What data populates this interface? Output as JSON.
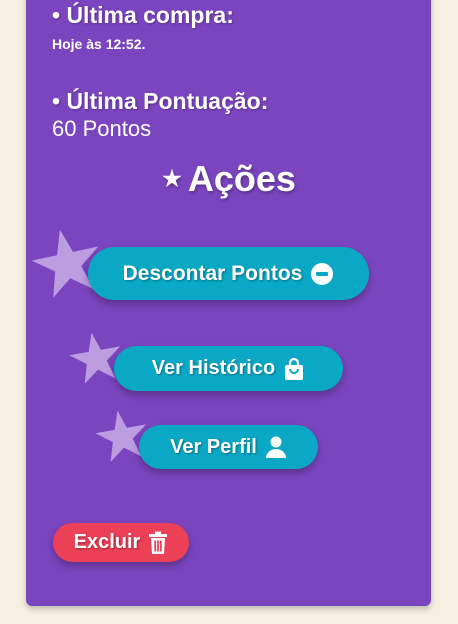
{
  "info": {
    "last_purchase_label": "• Última compra:",
    "last_purchase_value": "Hoje às 12:52.",
    "last_score_label": "• Última Pontuação:",
    "last_score_value": "60 Pontos"
  },
  "actions": {
    "heading": "Ações",
    "heading_icon": "star-icon",
    "discount_label": "Descontar Pontos",
    "discount_icon": "minus-circle-icon",
    "history_label": "Ver Histórico",
    "history_icon": "shopping-bag-icon",
    "profile_label": "Ver Perfil",
    "profile_icon": "user-icon",
    "delete_label": "Excluir",
    "delete_icon": "trash-icon"
  },
  "colors": {
    "page_bg": "#f6efe2",
    "card_bg": "#7b45bf",
    "button_primary": "#0aa8c4",
    "button_danger": "#ec4057",
    "decor_star": "#c8aee6"
  }
}
